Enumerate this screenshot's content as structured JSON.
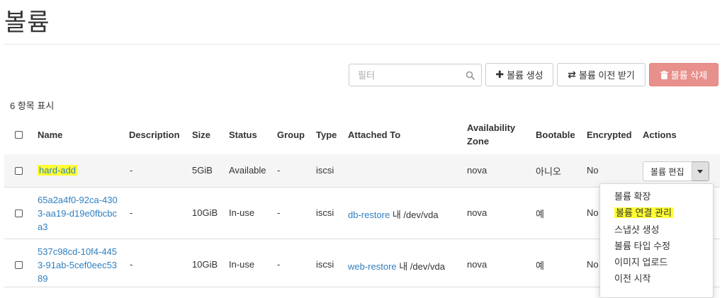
{
  "page": {
    "title": "볼륨"
  },
  "toolbar": {
    "filter_placeholder": "필터",
    "create_label": "볼륨 생성",
    "transfer_label": "볼륨 이전 받기",
    "delete_label": "볼륨 삭제"
  },
  "table": {
    "count_text": "6 항목 표시",
    "headers": {
      "name": "Name",
      "description": "Description",
      "size": "Size",
      "status": "Status",
      "group": "Group",
      "type": "Type",
      "attached": "Attached To",
      "az_line1": "Availability",
      "az_line2": "Zone",
      "bootable": "Bootable",
      "encrypted": "Encrypted",
      "actions": "Actions"
    },
    "rows": [
      {
        "name": "hard-add",
        "description": "-",
        "size": "5GiB",
        "status": "Available",
        "group": "-",
        "type": "iscsi",
        "az": "nova",
        "bootable": "아니오",
        "encrypted": "No"
      },
      {
        "name_lines": [
          "65a2a4f0-92ca-430",
          "3-aa19-d19e0fbcbc",
          "a3"
        ],
        "description": "-",
        "size": "10GiB",
        "status": "In-use",
        "group": "-",
        "type": "iscsi",
        "attached_link": "db-restore",
        "attached_rest": " 내 /dev/vda",
        "az": "nova",
        "bootable": "예",
        "encrypted": "No"
      },
      {
        "name_lines": [
          "537c98cd-10f4-445",
          "3-91ab-5cef0eec53",
          "89"
        ],
        "description": "-",
        "size": "10GiB",
        "status": "In-use",
        "group": "-",
        "type": "iscsi",
        "attached_link": "web-restore",
        "attached_rest": " 내 /dev/vda",
        "az": "nova",
        "bootable": "예",
        "encrypted": "No"
      }
    ]
  },
  "actions": {
    "edit_label": "볼륨 편집",
    "menu": [
      "볼륨 확장",
      "볼륨 연결 관리",
      "스냅샷 생성",
      "볼륨 타입 수정",
      "이미지 업로드",
      "이전 시작"
    ]
  },
  "colors": {
    "link": "#2f7fbf",
    "danger": "#e8908c",
    "highlight": "#ffff33"
  }
}
